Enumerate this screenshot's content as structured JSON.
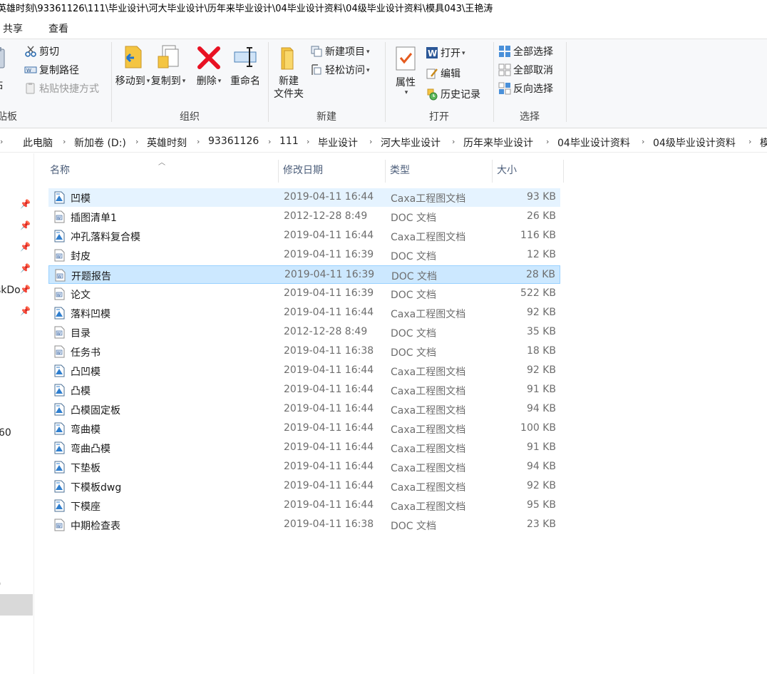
{
  "window": {
    "title": "英雄时刻\\93361126\\111\\毕业设计\\河大毕业设计\\历年来毕业设计\\04毕业设计资料\\04级毕业设计资料\\模具043\\王艳涛"
  },
  "ribbon_tabs": [
    "共享",
    "查看"
  ],
  "ribbon": {
    "clipboard": {
      "paste_partial": "贴",
      "cut": "剪切",
      "copy_path": "复制路径",
      "paste_shortcut": "粘贴快捷方式",
      "group_partial": "贴板"
    },
    "organize": {
      "move_to": "移动到",
      "copy_to": "复制到",
      "delete": "删除",
      "rename": "重命名",
      "group": "组织"
    },
    "new": {
      "new_folder_line1": "新建",
      "new_folder_line2": "文件夹",
      "new_item": "新建项目",
      "easy_access": "轻松访问",
      "group": "新建"
    },
    "open": {
      "properties": "属性",
      "open": "打开",
      "edit": "编辑",
      "history": "历史记录",
      "group": "打开"
    },
    "select": {
      "select_all": "全部选择",
      "select_none": "全部取消",
      "invert": "反向选择",
      "group": "选择"
    }
  },
  "address": {
    "crumbs": [
      "此电脑",
      "新加卷 (D:)",
      "英雄时刻",
      "93361126",
      "111",
      "毕业设计",
      "河大毕业设计",
      "历年来毕业设计",
      "04毕业设计资料",
      "04级毕业设计资料",
      "模"
    ]
  },
  "nav": {
    "partial_1": "skDo",
    "partial_2": "60",
    "partial_3": ")"
  },
  "columns": {
    "name": "名称",
    "date": "修改日期",
    "type": "类型",
    "size": "大小"
  },
  "files": [
    {
      "name": "凹模",
      "date": "2019-04-11 16:44",
      "type": "Caxa工程图文档",
      "size": "93 KB",
      "kind": "caxa"
    },
    {
      "name": "插图清单1",
      "date": "2012-12-28 8:49",
      "type": "DOC 文档",
      "size": "26 KB",
      "kind": "doc"
    },
    {
      "name": "冲孔落料复合模",
      "date": "2019-04-11 16:44",
      "type": "Caxa工程图文档",
      "size": "116 KB",
      "kind": "caxa"
    },
    {
      "name": "封皮",
      "date": "2019-04-11 16:39",
      "type": "DOC 文档",
      "size": "12 KB",
      "kind": "doc"
    },
    {
      "name": "开题报告",
      "date": "2019-04-11 16:39",
      "type": "DOC 文档",
      "size": "28 KB",
      "kind": "doc"
    },
    {
      "name": "论文",
      "date": "2019-04-11 16:39",
      "type": "DOC 文档",
      "size": "522 KB",
      "kind": "doc"
    },
    {
      "name": "落料凹模",
      "date": "2019-04-11 16:44",
      "type": "Caxa工程图文档",
      "size": "92 KB",
      "kind": "caxa"
    },
    {
      "name": "目录",
      "date": "2012-12-28 8:49",
      "type": "DOC 文档",
      "size": "35 KB",
      "kind": "doc"
    },
    {
      "name": "任务书",
      "date": "2019-04-11 16:38",
      "type": "DOC 文档",
      "size": "18 KB",
      "kind": "doc"
    },
    {
      "name": "凸凹模",
      "date": "2019-04-11 16:44",
      "type": "Caxa工程图文档",
      "size": "92 KB",
      "kind": "caxa"
    },
    {
      "name": "凸模",
      "date": "2019-04-11 16:44",
      "type": "Caxa工程图文档",
      "size": "91 KB",
      "kind": "caxa"
    },
    {
      "name": "凸模固定板",
      "date": "2019-04-11 16:44",
      "type": "Caxa工程图文档",
      "size": "94 KB",
      "kind": "caxa"
    },
    {
      "name": "弯曲模",
      "date": "2019-04-11 16:44",
      "type": "Caxa工程图文档",
      "size": "100 KB",
      "kind": "caxa"
    },
    {
      "name": "弯曲凸模",
      "date": "2019-04-11 16:44",
      "type": "Caxa工程图文档",
      "size": "91 KB",
      "kind": "caxa"
    },
    {
      "name": "下垫板",
      "date": "2019-04-11 16:44",
      "type": "Caxa工程图文档",
      "size": "94 KB",
      "kind": "caxa"
    },
    {
      "name": "下模板dwg",
      "date": "2019-04-11 16:44",
      "type": "Caxa工程图文档",
      "size": "92 KB",
      "kind": "caxa"
    },
    {
      "name": "下模座",
      "date": "2019-04-11 16:44",
      "type": "Caxa工程图文档",
      "size": "95 KB",
      "kind": "caxa"
    },
    {
      "name": "中期检查表",
      "date": "2019-04-11 16:38",
      "type": "DOC 文档",
      "size": "23 KB",
      "kind": "doc"
    }
  ],
  "state": {
    "hover_index": 0,
    "selected_index": 4
  },
  "colors": {
    "accent": "#cce8ff",
    "hover": "#e5f3ff",
    "delete_red": "#e81123",
    "folder": "#f4c542"
  }
}
